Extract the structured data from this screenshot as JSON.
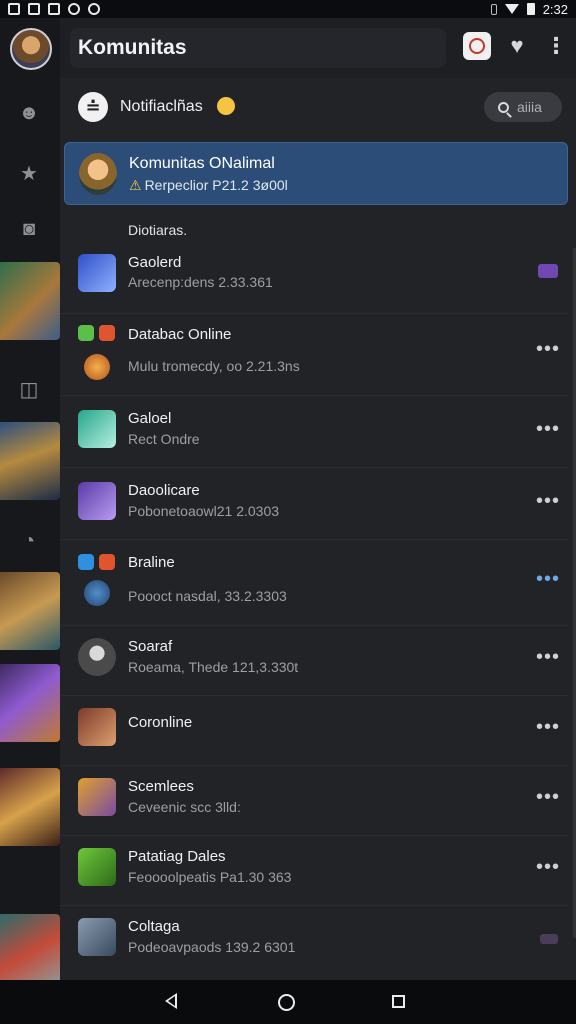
{
  "status_bar": {
    "time": "2:32"
  },
  "app": {
    "title": "Komunitas"
  },
  "notifications": {
    "title": "Notifiaclñas",
    "search_placeholder": "aiiia"
  },
  "featured": {
    "title": "Komunitas ONalimal",
    "subtitle": "Rerpeclior P21.2 3ø00l"
  },
  "section_label": "Diotiaras.",
  "items": [
    {
      "name": "Gaolerd",
      "sub": "Arecenp:dens 2.33.361",
      "action": "chip"
    },
    {
      "name": "Databac Online",
      "sub": "Mulu tromecdy, oo 2.21.3ns",
      "action": "more"
    },
    {
      "name": "Galoel",
      "sub": "Rect Ondre",
      "action": "more"
    },
    {
      "name": "Daoolicare",
      "sub": "Pobonetoaowl21 2.0303",
      "action": "more"
    },
    {
      "name": "Braline",
      "sub": "Poooct nasdal, 33.2.3303",
      "action": "more"
    },
    {
      "name": "Soaraf",
      "sub": "Roeama, Thede 121,3.330t",
      "action": "more"
    },
    {
      "name": "Coronline",
      "sub": "",
      "action": "more"
    },
    {
      "name": "Scemlees",
      "sub": "Ceveenic scc 3lld:",
      "action": "more"
    },
    {
      "name": "Patatiag Dales",
      "sub": "Feoooolpeatis Pa1.30 363",
      "action": "more"
    },
    {
      "name": "Coltaga",
      "sub": "Podeoavpaods 139.2 6301",
      "action": "chip"
    }
  ],
  "icons": {
    "rail": [
      "smiley-icon",
      "star-icon",
      "camera-icon",
      "chart-icon",
      "compass-icon"
    ],
    "topbar": [
      "camera-icon",
      "heart-icon",
      "more-vertical-icon"
    ]
  },
  "colors": {
    "accent": "#2c4d77",
    "background": "#222327"
  }
}
